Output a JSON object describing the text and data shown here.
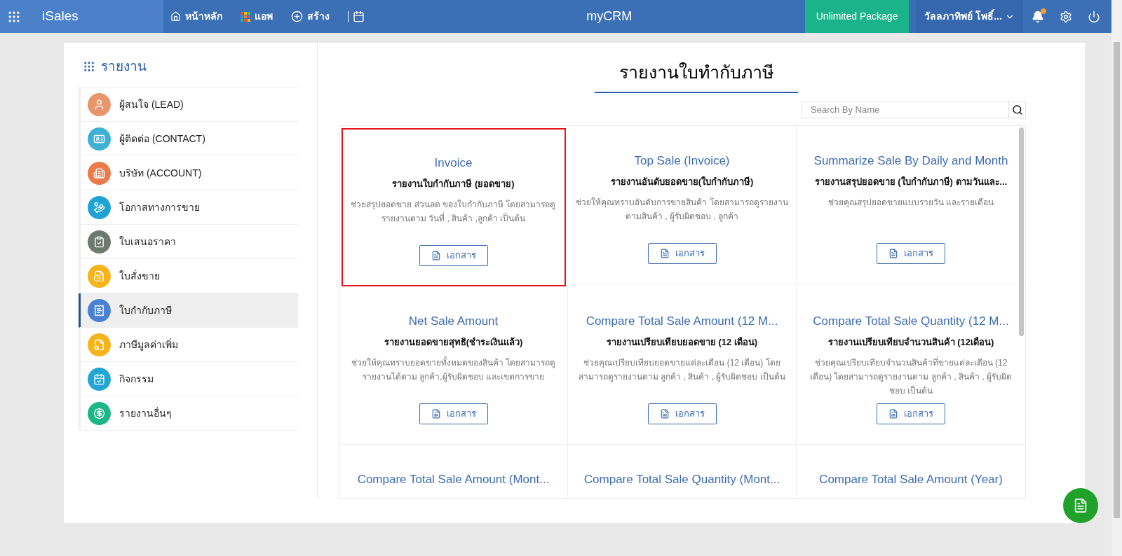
{
  "topbar": {
    "app_name": "iSales",
    "nav": [
      {
        "label": "หน้าหลัก"
      },
      {
        "label": "แอพ"
      },
      {
        "label": "สร้าง"
      }
    ],
    "logo": "myCRM",
    "package_button": "Unlimited Package",
    "user": "วัลลภาทิพย์ โพธิ์..."
  },
  "sidebar": {
    "title": "รายงาน",
    "items": [
      {
        "label": "ผู้สนใจ (LEAD)",
        "color": "#e8956b",
        "selected": false
      },
      {
        "label": "ผู้ติดต่อ (CONTACT)",
        "color": "#3fb1d6",
        "selected": false
      },
      {
        "label": "บริษัท (ACCOUNT)",
        "color": "#ec7b4a",
        "selected": false
      },
      {
        "label": "โอกาสทางการขาย",
        "color": "#1ea3d6",
        "selected": false
      },
      {
        "label": "ใบเสนอราคา",
        "color": "#6d7a70",
        "selected": false
      },
      {
        "label": "ใบสั่งขาย",
        "color": "#f4b41a",
        "selected": false
      },
      {
        "label": "ใบกำกับภาษี",
        "color": "#4a82d3",
        "selected": true
      },
      {
        "label": "ภาษีมูลค่าเพิ่ม",
        "color": "#f4b41a",
        "selected": false
      },
      {
        "label": "กิจกรรม",
        "color": "#23a6d3",
        "selected": false
      },
      {
        "label": "รายงานอื่นๆ",
        "color": "#1fb685",
        "selected": false
      }
    ]
  },
  "main": {
    "title": "รายงานใบทำกับภาษี",
    "search": {
      "placeholder": "Search By Name"
    },
    "cards": [
      {
        "title": "Invoice",
        "subtitle": "รายงานใบกำกับภาษี (ยอดขาย)",
        "description": "ช่วยสรุปยอดขาย ส่วนลด ของใบกำกับภาษี โดยสามารถดูรายงานตาม วันที่ , สินค้า ,ลูกค้า เป็นต้น",
        "button": "เอกสาร",
        "selected": true
      },
      {
        "title": "Top Sale (Invoice)",
        "subtitle": "รายงานอันดับยอดขาย(ใบกำกับภาษี)",
        "description": "ช่วยให้คุณทราบอันดับการขายสินค้า โดยสามารถดูรายงานตามสินค้า , ผู้รับผิดชอบ , ลูกค้า",
        "button": "เอกสาร",
        "selected": false
      },
      {
        "title": "Summarize Sale By Daily and Month",
        "subtitle": "รายงานสรุปยอดขาย (ใบกำกับภาษี) ตามวันและ...",
        "description": "ช่วยคุณสรุปยอดขายแบบรายวัน และรายเดือน",
        "button": "เอกสาร",
        "selected": false
      },
      {
        "title": "Net Sale Amount",
        "subtitle": "รายงานยอดขายสุทธิ(ชำระเงินแล้ว)",
        "description": "ช่วยให้คุณทราบยอดขายทั้งหมดของสินค้า โดยสามารถดูรายงานได้ตาม ลูกค้า,ผู้รับผิดชอบ และเขตการขาย",
        "button": "เอกสาร",
        "selected": false
      },
      {
        "title": "Compare Total Sale Amount (12 M...",
        "subtitle": "รายงานเปรียบเทียบยอดขาย (12 เดือน)",
        "description": "ช่วยคุณเปรียบเทียบยอดขายแต่ละเดือน (12 เดือน) โดยสามารถดูรายงานตาม ลูกค้า , สินค้า , ผู้รับผิดชอบ เป็นต้น",
        "button": "เอกสาร",
        "selected": false
      },
      {
        "title": "Compare Total Sale Quantity (12 M...",
        "subtitle": "รายงานเปรียบเทียบจำนวนสินค้า (12เดือน)",
        "description": "ช่วยคุณเปรียบเทียบจำนวนสินค้าที่ขายแต่ละเดือน (12 เดือน) โดยสามารถดูรายงานตาม ลูกค้า , สินค้า , ผู้รับผิดชอบ เป็นต้น",
        "button": "เอกสาร",
        "selected": false
      },
      {
        "title": "Compare Total Sale Amount (Mont...",
        "selected": false
      },
      {
        "title": "Compare Total Sale Quantity (Mont...",
        "selected": false
      },
      {
        "title": "Compare Total Sale Amount (Year)",
        "selected": false
      }
    ]
  }
}
